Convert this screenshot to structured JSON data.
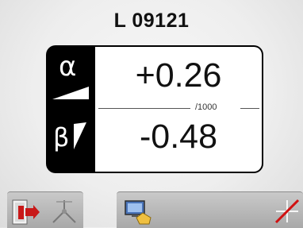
{
  "header": {
    "device_id": "L 09121"
  },
  "readout": {
    "alpha": {
      "symbol": "α",
      "value": "+0.26",
      "icon": "alpha-wedge-icon"
    },
    "beta": {
      "symbol": "β",
      "value": "-0.48",
      "icon": "beta-wedge-icon"
    },
    "unit": "/1000"
  },
  "toolbar": {
    "left": [
      {
        "name": "exit-button",
        "icon": "exit-door-icon"
      },
      {
        "name": "measure-button",
        "icon": "caliper-icon"
      }
    ],
    "right": [
      {
        "name": "display-settings-button",
        "icon": "monitor-hand-icon"
      },
      {
        "name": "reset-button",
        "icon": "crosshair-cancel-icon"
      }
    ]
  },
  "colors": {
    "panel_black": "#000000",
    "value_white": "#ffffff",
    "accent_red": "#d01010",
    "toolbar_gray": "#b8b8b8"
  }
}
